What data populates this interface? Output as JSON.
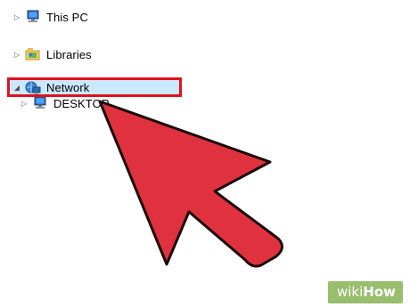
{
  "nav_tree": {
    "items": [
      {
        "label": "This PC",
        "expander": "collapsed",
        "icon": "computer-icon"
      },
      {
        "label": "Libraries",
        "expander": "collapsed",
        "icon": "libraries-icon"
      },
      {
        "label": "Network",
        "expander": "expanded",
        "icon": "network-icon",
        "selected": true
      },
      {
        "label": "DESKTOP",
        "expander": "collapsed",
        "icon": "computer-icon"
      }
    ]
  },
  "annotation": {
    "highlight_color": "#e0111c",
    "arrow_color": "#e0313f",
    "arrow_outline": "#1a0a0a"
  },
  "watermark": {
    "part1": "wiki",
    "part2": "How",
    "color": "#92bb66"
  },
  "colors": {
    "selection": "#cce8ff",
    "background": "#ffffff"
  }
}
